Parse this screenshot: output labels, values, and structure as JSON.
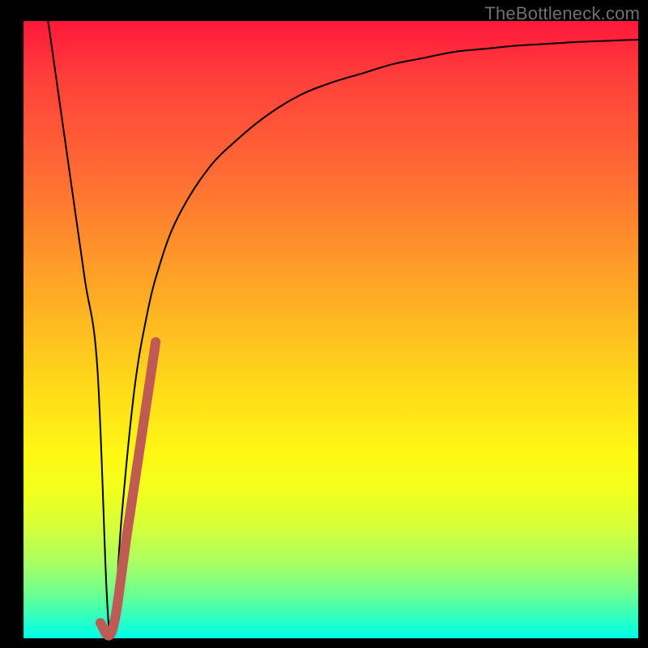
{
  "watermark": "TheBottleneck.com",
  "colors": {
    "curve": "#000000",
    "highlight": "#c05a54",
    "background_frame": "#000000"
  },
  "chart_data": {
    "type": "line",
    "title": "",
    "xlabel": "",
    "ylabel": "",
    "xlim": [
      0,
      100
    ],
    "ylim": [
      0,
      100
    ],
    "grid": false,
    "legend": false,
    "series": [
      {
        "name": "bottleneck-curve",
        "color": "#000000",
        "x": [
          4,
          6,
          8,
          10,
          12,
          13.5,
          14.2,
          15,
          16,
          18,
          20,
          22,
          25,
          30,
          35,
          40,
          45,
          50,
          55,
          60,
          65,
          70,
          75,
          80,
          85,
          90,
          95,
          100
        ],
        "y": [
          100,
          86,
          72,
          58,
          44,
          8,
          1,
          6,
          20,
          40,
          52,
          60,
          68,
          76,
          81,
          85,
          88,
          90,
          91.5,
          93,
          94,
          95,
          95.5,
          96,
          96.3,
          96.6,
          96.8,
          97
        ]
      },
      {
        "name": "highlight-segment",
        "color": "#c05a54",
        "x": [
          12.5,
          14.5,
          17,
          21.5
        ],
        "y": [
          2.5,
          1.5,
          18,
          48
        ]
      }
    ]
  }
}
